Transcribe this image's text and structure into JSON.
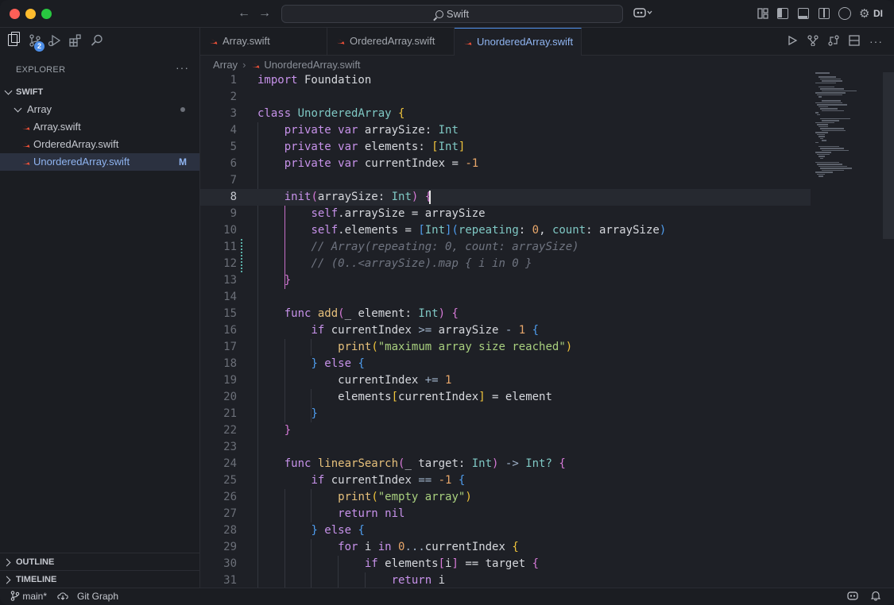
{
  "titlebar": {
    "search_text": "Swift",
    "user_initials": "DI"
  },
  "sidebar": {
    "badge_count": "2",
    "explorer_label": "EXPLORER",
    "more_label": "···",
    "root_folder": "SWIFT",
    "folder": "Array",
    "files": [
      {
        "name": "Array.swift",
        "status": ""
      },
      {
        "name": "OrderedArray.swift",
        "status": ""
      },
      {
        "name": "UnorderedArray.swift",
        "status": "M"
      }
    ],
    "outline_label": "OUTLINE",
    "timeline_label": "TIMELINE"
  },
  "tabs": [
    {
      "label": "Array.swift"
    },
    {
      "label": "OrderedArray.swift"
    },
    {
      "label": "UnorderedArray.swift"
    }
  ],
  "breadcrumb": {
    "folder": "Array",
    "file": "UnorderedArray.swift"
  },
  "editor": {
    "line_numbers": [
      "1",
      "2",
      "3",
      "4",
      "5",
      "6",
      "7",
      "8",
      "9",
      "10",
      "11",
      "12",
      "13",
      "14",
      "15",
      "16",
      "17",
      "18",
      "19",
      "20",
      "21",
      "22",
      "23",
      "24",
      "25",
      "26",
      "27",
      "28",
      "29",
      "30",
      "31"
    ],
    "current_line": "8",
    "code": {
      "l1a": "import",
      "l1b": " Foundation",
      "l3a": "class",
      "l3b": " UnorderedArray ",
      "l3c": "{",
      "l4a": "private",
      "l4b": " var",
      "l4c": " arraySize",
      "l4d": ": ",
      "l4e": "Int",
      "l5a": "private",
      "l5b": " var",
      "l5c": " elements",
      "l5d": ": ",
      "l5e": "[",
      "l5f": "Int",
      "l5g": "]",
      "l6a": "private",
      "l6b": " var",
      "l6c": " currentIndex",
      "l6d": " = ",
      "l6e": "-1",
      "l8a": "init",
      "l8b": "(",
      "l8c": "arraySize",
      "l8d": ": ",
      "l8e": "Int",
      "l8f": ")",
      "l8g": " {",
      "l9a": "self",
      "l9b": ".arraySize = arraySize",
      "l10a": "self",
      "l10b": ".elements = ",
      "l10c": "[",
      "l10d": "Int",
      "l10e": "]",
      "l10f": "(",
      "l10g": "repeating",
      "l10h": ": ",
      "l10i": "0",
      "l10j": ", ",
      "l10k": "count",
      "l10l": ": arraySize",
      "l10m": ")",
      "l11": "// Array(repeating: 0, count: arraySize)",
      "l12": "// (0..<arraySize).map { i in 0 }",
      "l13": "}",
      "l15a": "func",
      "l15b": " add",
      "l15c": "(",
      "l15d": "_ element",
      "l15e": ": ",
      "l15f": "Int",
      "l15g": ")",
      "l15h": " {",
      "l16a": "if",
      "l16b": " currentIndex ",
      "l16c": ">=",
      "l16d": " arraySize ",
      "l16e": "- ",
      "l16f": "1",
      "l16g": " {",
      "l17a": "print",
      "l17b": "(",
      "l17c": "\"maximum array size reached\"",
      "l17d": ")",
      "l18a": "}",
      "l18b": " else",
      "l18c": " {",
      "l19a": "currentIndex ",
      "l19b": "+=",
      "l19c": " 1",
      "l20a": "elements",
      "l20b": "[",
      "l20c": "currentIndex",
      "l20d": "]",
      "l20e": " = element",
      "l21": "}",
      "l22": "}",
      "l24a": "func",
      "l24b": " linearSearch",
      "l24c": "(",
      "l24d": "_ target",
      "l24e": ": ",
      "l24f": "Int",
      "l24g": ")",
      "l24h": " -> ",
      "l24i": "Int?",
      "l24j": " {",
      "l25a": "if",
      "l25b": " currentIndex ",
      "l25c": "==",
      "l25d": " -1",
      "l25e": " {",
      "l26a": "print",
      "l26b": "(",
      "l26c": "\"empty array\"",
      "l26d": ")",
      "l27a": "return",
      "l27b": " nil",
      "l28a": "}",
      "l28b": " else",
      "l28c": " {",
      "l29a": "for",
      "l29b": " i ",
      "l29c": "in",
      "l29d": " 0",
      "l29e": "...",
      "l29f": "currentIndex",
      "l29g": " {",
      "l30a": "if",
      "l30b": " elements",
      "l30c": "[",
      "l30d": "i",
      "l30e": "]",
      "l30f": " == target",
      "l30g": " {",
      "l31a": "return",
      "l31b": " i"
    }
  },
  "statusbar": {
    "branch": "main*",
    "git_graph": "Git Graph"
  },
  "colors": {
    "accent": "#4d8ee8",
    "traffic_red": "#ff5f57",
    "traffic_yellow": "#febc2e",
    "traffic_green": "#28c840",
    "swift_orange": "#f05138"
  },
  "icons": {
    "swift_file": "swift-bird-icon",
    "explorer": "files-icon",
    "scm": "source-control-icon",
    "run": "run-debug-icon",
    "extensions": "extensions-icon",
    "search": "search-icon"
  }
}
